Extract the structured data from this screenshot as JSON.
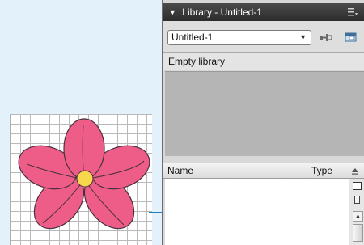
{
  "panel": {
    "title": "Library - Untitled-1",
    "document_select": {
      "value": "Untitled-1"
    },
    "status_text": "Empty library",
    "columns": {
      "name": "Name",
      "type": "Type"
    }
  },
  "icons": {
    "collapse": "triangle-down-icon",
    "panel_menu": "panel-menu-icon",
    "pin": "pin-icon",
    "new_library": "new-library-panel-icon",
    "sort": "sort-order-icon"
  },
  "colors": {
    "flower_petal": "#ee5d87",
    "flower_center": "#f7d74c",
    "arrow": "#1f7fbf"
  }
}
